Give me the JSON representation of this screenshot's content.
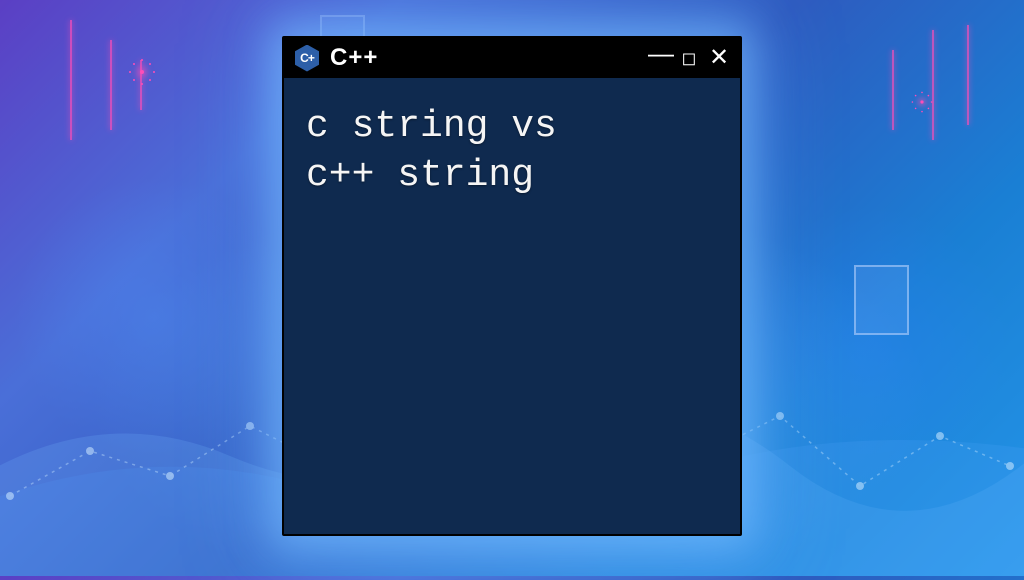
{
  "window": {
    "title": "C++",
    "icon_letter": "C+",
    "body_line1": "c string vs",
    "body_line2": "c++ string"
  },
  "colors": {
    "window_bg": "#0f2a4f",
    "titlebar_bg": "#000000",
    "text": "#f5f5f5",
    "accent_pink": "#ff4db8",
    "accent_blue": "#4aa8ff"
  }
}
